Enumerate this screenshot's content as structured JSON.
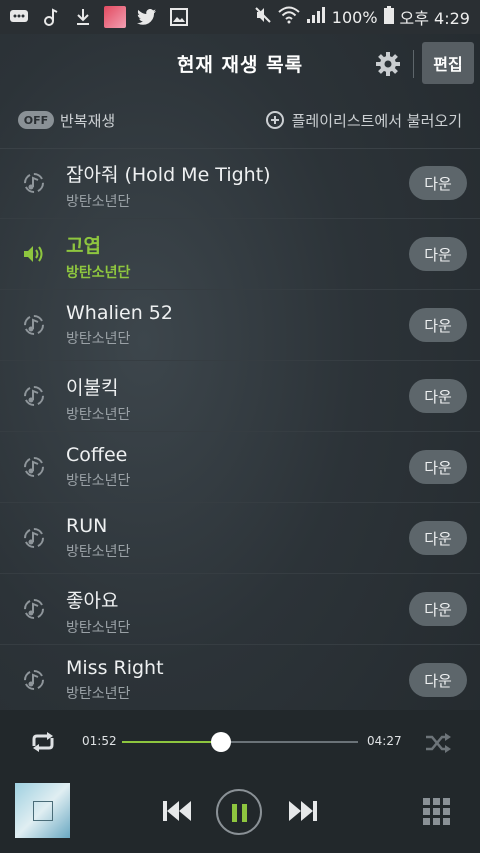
{
  "status_bar": {
    "battery": "100%",
    "time": "오후 4:29"
  },
  "header": {
    "title": "현재 재생 목록",
    "edit_label": "편집"
  },
  "options": {
    "repeat_toggle": "OFF",
    "repeat_label": "반복재생",
    "load_playlist_label": "플레이리스트에서 불러오기"
  },
  "playlist": [
    {
      "title": "잡아줘 (Hold Me Tight)",
      "artist": "방탄소년단",
      "download": "다운",
      "active": false
    },
    {
      "title": "고엽",
      "artist": "방탄소년단",
      "download": "다운",
      "active": true
    },
    {
      "title": "Whalien 52",
      "artist": "방탄소년단",
      "download": "다운",
      "active": false
    },
    {
      "title": "이불킥",
      "artist": "방탄소년단",
      "download": "다운",
      "active": false
    },
    {
      "title": "Coffee",
      "artist": "방탄소년단",
      "download": "다운",
      "active": false
    },
    {
      "title": "RUN",
      "artist": "방탄소년단",
      "download": "다운",
      "active": false
    },
    {
      "title": "좋아요",
      "artist": "방탄소년단",
      "download": "다운",
      "active": false
    },
    {
      "title": "Miss Right",
      "artist": "방탄소년단",
      "download": "다운",
      "active": false
    }
  ],
  "player": {
    "elapsed": "01:52",
    "duration": "04:27",
    "progress": 0.42,
    "state": "playing"
  },
  "colors": {
    "accent": "#8ec63f",
    "button_bg": "#5d666b"
  }
}
